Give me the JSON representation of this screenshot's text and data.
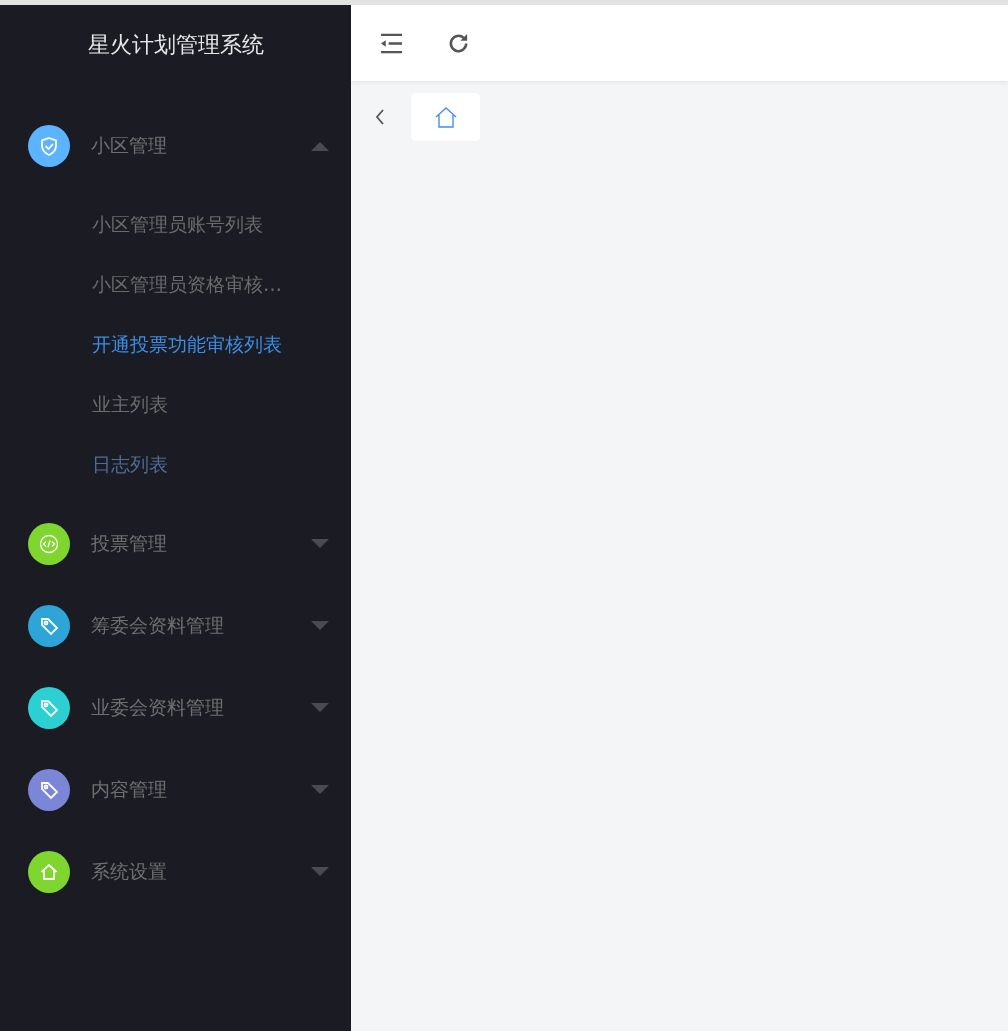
{
  "sidebar": {
    "title": "星火计划管理系统",
    "groups": [
      {
        "label": "小区管理",
        "kind": "shield",
        "color": "#5cb3ff",
        "expanded": true,
        "children": [
          {
            "label": "小区管理员账号列表",
            "selected": false,
            "hovered": false
          },
          {
            "label": "小区管理员资格审核…",
            "selected": false,
            "hovered": false
          },
          {
            "label": "开通投票功能审核列表",
            "selected": true,
            "hovered": false
          },
          {
            "label": "业主列表",
            "selected": false,
            "hovered": false
          },
          {
            "label": "日志列表",
            "selected": false,
            "hovered": true
          }
        ]
      },
      {
        "label": "投票管理",
        "kind": "code",
        "color": "#7ed62e",
        "expanded": false
      },
      {
        "label": "筹委会资料管理",
        "kind": "tag",
        "color": "#2ea5d8",
        "expanded": false
      },
      {
        "label": "业委会资料管理",
        "kind": "tag",
        "color": "#2ccfd2",
        "expanded": false
      },
      {
        "label": "内容管理",
        "kind": "tag",
        "color": "#7b86d6",
        "expanded": false
      },
      {
        "label": "系统设置",
        "kind": "home",
        "color": "#7ed62e",
        "expanded": false
      }
    ]
  },
  "tags_bar": {
    "tabs": [
      {
        "kind": "home",
        "selected": true
      }
    ]
  }
}
